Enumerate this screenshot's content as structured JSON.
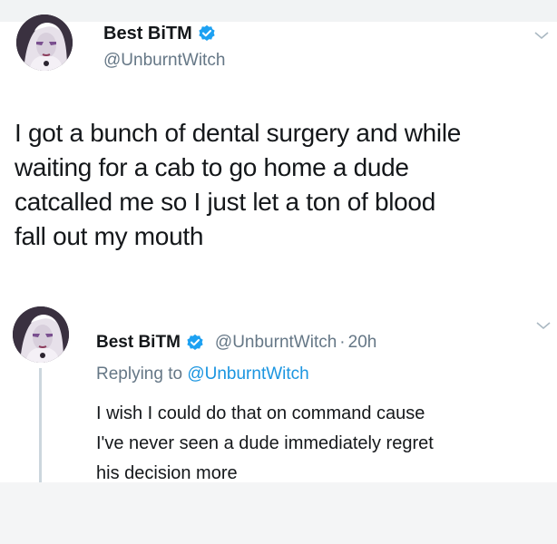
{
  "main_tweet": {
    "display_name": "Best BiTM",
    "handle": "@UnburntWitch",
    "text_lines": [
      "I got a bunch of dental surgery and while",
      "waiting for a cab to go home a dude",
      "catcalled me so I just let a ton of blood",
      "fall out my mouth"
    ]
  },
  "reply_tweet": {
    "display_name": "Best BiTM",
    "handle": "@UnburntWitch",
    "separator": "·",
    "time": "20h",
    "replying_to_label": "Replying to",
    "replying_to_mention": "@UnburntWitch",
    "text_lines": [
      "I wish I could do that on command cause",
      "I've never seen a dude immediately regret",
      "his decision more"
    ]
  },
  "icons": {
    "verified": "verified-badge-icon",
    "chevron": "chevron-down-icon",
    "avatar": "avatar"
  },
  "colors": {
    "verified_blue": "#1da1f2",
    "secondary_text": "#657786",
    "link_blue": "#1b95e0",
    "primary_text": "#14171a"
  }
}
